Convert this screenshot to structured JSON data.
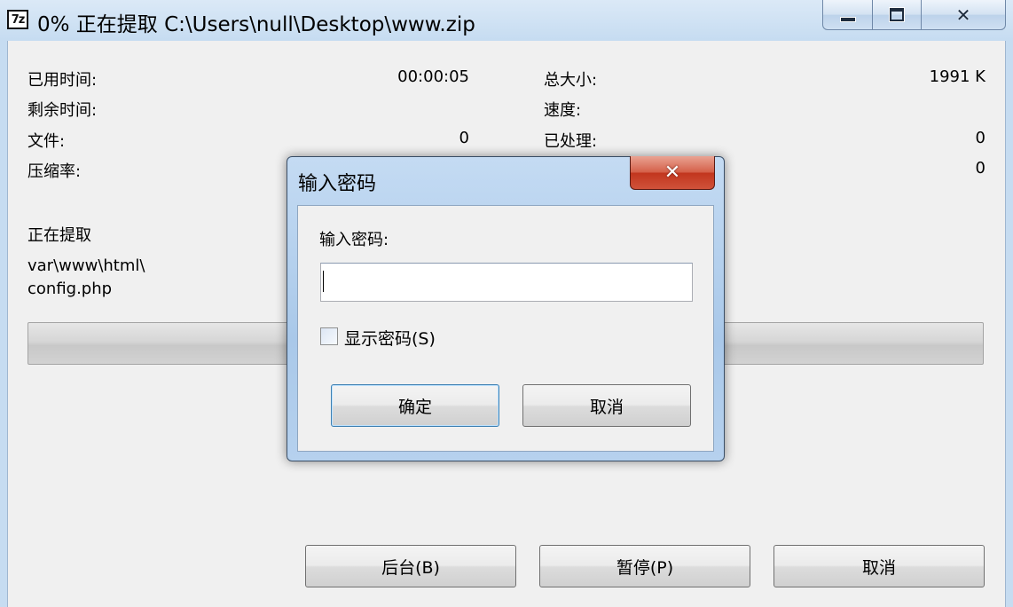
{
  "window": {
    "icon_text": "7z",
    "title": "0% 正在提取 C:\\Users\\null\\Desktop\\www.zip"
  },
  "stats": {
    "elapsed_label": "已用时间:",
    "elapsed_value": "00:00:05",
    "remaining_label": "剩余时间:",
    "files_label": "文件:",
    "files_value": "0",
    "ratio_label": "压缩率:",
    "total_size_label": "总大小:",
    "total_size_value": "1991 K",
    "speed_label": "速度:",
    "processed_label": "已处理:",
    "processed_value": "0",
    "packed_value": "0"
  },
  "extracting": {
    "status_label": "正在提取",
    "path_line1": "var\\www\\html\\",
    "path_line2": "config.php",
    "progress_fraction": 0
  },
  "buttons": {
    "background": "后台(B)",
    "pause": "暂停(P)",
    "cancel": "取消"
  },
  "dialog": {
    "title": "输入密码",
    "prompt": "输入密码:",
    "password_value": "",
    "show_password": "显示密码(S)",
    "show_password_checked": false,
    "ok": "确定",
    "cancel": "取消"
  }
}
